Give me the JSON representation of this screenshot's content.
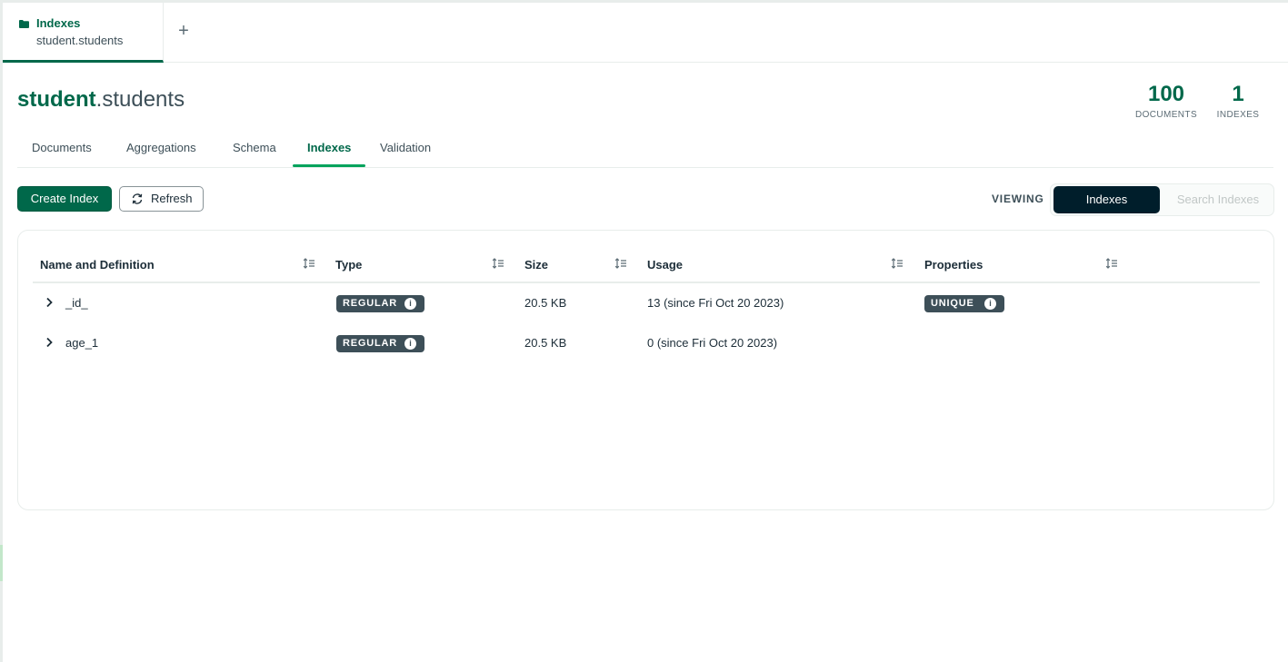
{
  "workspace_tab": {
    "title": "Indexes",
    "subtitle": "student.students",
    "icon": "folder-icon",
    "new_tab_symbol": "+"
  },
  "header": {
    "database": "student",
    "separator_collection": ".students",
    "stats": {
      "documents_count": "100",
      "documents_label": "DOCUMENTS",
      "indexes_count": "1",
      "indexes_label": "INDEXES"
    }
  },
  "subtabs": [
    {
      "label": "Documents",
      "active": false
    },
    {
      "label": "Aggregations",
      "active": false
    },
    {
      "label": "Schema",
      "active": false
    },
    {
      "label": "Indexes",
      "active": true
    },
    {
      "label": "Validation",
      "active": false
    }
  ],
  "toolbar": {
    "create_label": "Create Index",
    "refresh_label": "Refresh",
    "viewing_label": "VIEWING",
    "view_options": [
      "Indexes",
      "Search Indexes"
    ],
    "selected_view": "Indexes"
  },
  "table": {
    "columns": [
      "Name and Definition",
      "Type",
      "Size",
      "Usage",
      "Properties"
    ],
    "rows": [
      {
        "name": "_id_",
        "type": "REGULAR",
        "size": "20.5 KB",
        "usage": "13 (since Fri Oct 20 2023)",
        "properties": "UNIQUE"
      },
      {
        "name": "age_1",
        "type": "REGULAR",
        "size": "20.5 KB",
        "usage": "0 (since Fri Oct 20 2023)",
        "properties": ""
      }
    ]
  },
  "colors": {
    "brand_green": "#00684a",
    "accent_green": "#00a35c",
    "dark": "#001e2b",
    "badge": "#3d4f58"
  }
}
